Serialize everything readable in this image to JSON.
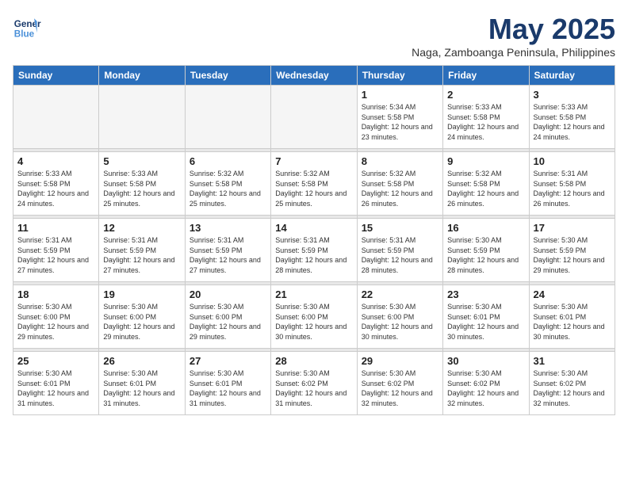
{
  "logo": {
    "line1": "General",
    "line2": "Blue"
  },
  "title": "May 2025",
  "location": "Naga, Zamboanga Peninsula, Philippines",
  "days_of_week": [
    "Sunday",
    "Monday",
    "Tuesday",
    "Wednesday",
    "Thursday",
    "Friday",
    "Saturday"
  ],
  "weeks": [
    [
      {
        "day": "",
        "detail": ""
      },
      {
        "day": "",
        "detail": ""
      },
      {
        "day": "",
        "detail": ""
      },
      {
        "day": "",
        "detail": ""
      },
      {
        "day": "1",
        "detail": "Sunrise: 5:34 AM\nSunset: 5:58 PM\nDaylight: 12 hours\nand 23 minutes."
      },
      {
        "day": "2",
        "detail": "Sunrise: 5:33 AM\nSunset: 5:58 PM\nDaylight: 12 hours\nand 24 minutes."
      },
      {
        "day": "3",
        "detail": "Sunrise: 5:33 AM\nSunset: 5:58 PM\nDaylight: 12 hours\nand 24 minutes."
      }
    ],
    [
      {
        "day": "4",
        "detail": "Sunrise: 5:33 AM\nSunset: 5:58 PM\nDaylight: 12 hours\nand 24 minutes."
      },
      {
        "day": "5",
        "detail": "Sunrise: 5:33 AM\nSunset: 5:58 PM\nDaylight: 12 hours\nand 25 minutes."
      },
      {
        "day": "6",
        "detail": "Sunrise: 5:32 AM\nSunset: 5:58 PM\nDaylight: 12 hours\nand 25 minutes."
      },
      {
        "day": "7",
        "detail": "Sunrise: 5:32 AM\nSunset: 5:58 PM\nDaylight: 12 hours\nand 25 minutes."
      },
      {
        "day": "8",
        "detail": "Sunrise: 5:32 AM\nSunset: 5:58 PM\nDaylight: 12 hours\nand 26 minutes."
      },
      {
        "day": "9",
        "detail": "Sunrise: 5:32 AM\nSunset: 5:58 PM\nDaylight: 12 hours\nand 26 minutes."
      },
      {
        "day": "10",
        "detail": "Sunrise: 5:31 AM\nSunset: 5:58 PM\nDaylight: 12 hours\nand 26 minutes."
      }
    ],
    [
      {
        "day": "11",
        "detail": "Sunrise: 5:31 AM\nSunset: 5:59 PM\nDaylight: 12 hours\nand 27 minutes."
      },
      {
        "day": "12",
        "detail": "Sunrise: 5:31 AM\nSunset: 5:59 PM\nDaylight: 12 hours\nand 27 minutes."
      },
      {
        "day": "13",
        "detail": "Sunrise: 5:31 AM\nSunset: 5:59 PM\nDaylight: 12 hours\nand 27 minutes."
      },
      {
        "day": "14",
        "detail": "Sunrise: 5:31 AM\nSunset: 5:59 PM\nDaylight: 12 hours\nand 28 minutes."
      },
      {
        "day": "15",
        "detail": "Sunrise: 5:31 AM\nSunset: 5:59 PM\nDaylight: 12 hours\nand 28 minutes."
      },
      {
        "day": "16",
        "detail": "Sunrise: 5:30 AM\nSunset: 5:59 PM\nDaylight: 12 hours\nand 28 minutes."
      },
      {
        "day": "17",
        "detail": "Sunrise: 5:30 AM\nSunset: 5:59 PM\nDaylight: 12 hours\nand 29 minutes."
      }
    ],
    [
      {
        "day": "18",
        "detail": "Sunrise: 5:30 AM\nSunset: 6:00 PM\nDaylight: 12 hours\nand 29 minutes."
      },
      {
        "day": "19",
        "detail": "Sunrise: 5:30 AM\nSunset: 6:00 PM\nDaylight: 12 hours\nand 29 minutes."
      },
      {
        "day": "20",
        "detail": "Sunrise: 5:30 AM\nSunset: 6:00 PM\nDaylight: 12 hours\nand 29 minutes."
      },
      {
        "day": "21",
        "detail": "Sunrise: 5:30 AM\nSunset: 6:00 PM\nDaylight: 12 hours\nand 30 minutes."
      },
      {
        "day": "22",
        "detail": "Sunrise: 5:30 AM\nSunset: 6:00 PM\nDaylight: 12 hours\nand 30 minutes."
      },
      {
        "day": "23",
        "detail": "Sunrise: 5:30 AM\nSunset: 6:01 PM\nDaylight: 12 hours\nand 30 minutes."
      },
      {
        "day": "24",
        "detail": "Sunrise: 5:30 AM\nSunset: 6:01 PM\nDaylight: 12 hours\nand 30 minutes."
      }
    ],
    [
      {
        "day": "25",
        "detail": "Sunrise: 5:30 AM\nSunset: 6:01 PM\nDaylight: 12 hours\nand 31 minutes."
      },
      {
        "day": "26",
        "detail": "Sunrise: 5:30 AM\nSunset: 6:01 PM\nDaylight: 12 hours\nand 31 minutes."
      },
      {
        "day": "27",
        "detail": "Sunrise: 5:30 AM\nSunset: 6:01 PM\nDaylight: 12 hours\nand 31 minutes."
      },
      {
        "day": "28",
        "detail": "Sunrise: 5:30 AM\nSunset: 6:02 PM\nDaylight: 12 hours\nand 31 minutes."
      },
      {
        "day": "29",
        "detail": "Sunrise: 5:30 AM\nSunset: 6:02 PM\nDaylight: 12 hours\nand 32 minutes."
      },
      {
        "day": "30",
        "detail": "Sunrise: 5:30 AM\nSunset: 6:02 PM\nDaylight: 12 hours\nand 32 minutes."
      },
      {
        "day": "31",
        "detail": "Sunrise: 5:30 AM\nSunset: 6:02 PM\nDaylight: 12 hours\nand 32 minutes."
      }
    ]
  ]
}
